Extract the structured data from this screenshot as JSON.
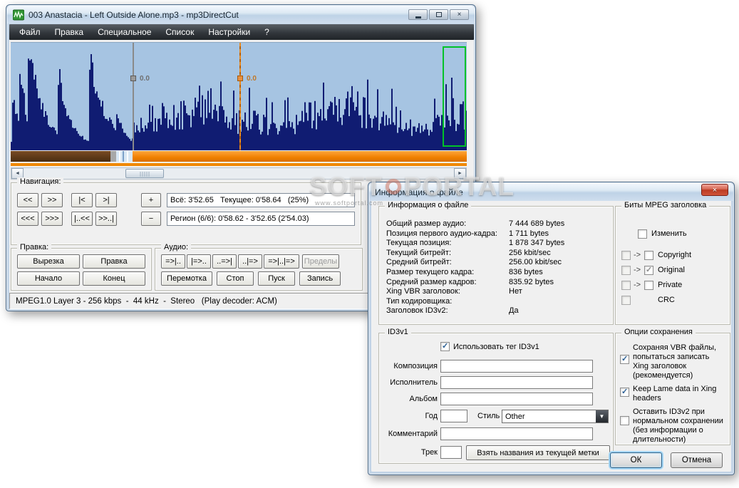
{
  "watermark": {
    "text_left": "SOFT",
    "text_right": "PORTAL",
    "url": "www.softportal.com"
  },
  "main_window": {
    "title": "003 Anastacia - Left Outside Alone.mp3 - mp3DirectCut",
    "menu": [
      "Файл",
      "Правка",
      "Специальное",
      "Список",
      "Настройки",
      "?"
    ],
    "waveform": {
      "marker_left_label": "0.0",
      "marker_right_label": "0.0"
    },
    "navigation": {
      "label": "Навигация:",
      "buttons_row1": [
        "<<",
        ">>",
        "|<",
        ">|",
        "+"
      ],
      "buttons_row2": [
        "<<<",
        ">>>",
        "|..<<",
        ">>..|",
        "−"
      ],
      "total_field": "Всё: 3'52.65   Текущее: 0'58.64   (25%)",
      "region_field": "Регион (6/6): 0'58.62 - 3'52.65 (2'54.03)"
    },
    "edit": {
      "label": "Правка:",
      "buttons": [
        "Вырезка",
        "Правка",
        "Начало",
        "Конец"
      ]
    },
    "audio": {
      "label": "Аудио:",
      "buttons_row1": [
        "=>|..",
        "|=>..",
        "..=>|",
        "..|=>",
        "=>|..|=>",
        "Пределы"
      ],
      "buttons_row2": [
        "Перемотка",
        "Стоп",
        "Пуск",
        "Запись"
      ]
    },
    "status_bar": "MPEG1.0 Layer 3 - 256 kbps  -  44 kHz  -  Stereo   (Play decoder: ACM)"
  },
  "dialog": {
    "title": "Информация о файле",
    "file_info": {
      "title": "Информация о файле",
      "rows": [
        {
          "label": "Общий размер аудио:",
          "value": "7 444 689 bytes"
        },
        {
          "label": "Позиция первого аудио-кадра:",
          "value": "1 711 bytes"
        },
        {
          "label": "Текущая позиция:",
          "value": "1 878 347 bytes"
        },
        {
          "label": "Текущий битрейт:",
          "value": "256 kbit/sec"
        },
        {
          "label": "Средний битрейт:",
          "value": "256.00 kbit/sec"
        },
        {
          "label": "Размер текущего кадра:",
          "value": "836 bytes"
        },
        {
          "label": "Средний размер кадров:",
          "value": "835.92 bytes"
        },
        {
          "label": "Xing VBR заголовок:",
          "value": "Нет"
        },
        {
          "label": "Тип кодировщика:",
          "value": ""
        },
        {
          "label": "Заголовок ID3v2:",
          "value": "Да"
        }
      ]
    },
    "mpeg_bits": {
      "title": "Биты MPEG заголовка",
      "change": {
        "label": "Изменить",
        "checked": false
      },
      "arrow": "->",
      "bits": [
        {
          "label": "Copyright",
          "source_checked": false,
          "checked": false
        },
        {
          "label": "Original",
          "source_checked": false,
          "checked": true
        },
        {
          "label": "Private",
          "source_checked": false,
          "checked": false
        }
      ],
      "crc": {
        "label": "CRC",
        "checked": false
      }
    },
    "id3v1": {
      "title": "ID3v1",
      "use_tag": {
        "label": "Использовать тег ID3v1",
        "checked": true
      },
      "fields": {
        "title_label": "Композиция",
        "artist_label": "Исполнитель",
        "album_label": "Альбом",
        "year_label": "Год",
        "genre_label": "Стиль",
        "genre_value": "Other",
        "comment_label": "Комментарий",
        "track_label": "Трек"
      },
      "take_names_button": "Взять названия из текущей метки"
    },
    "save_options": {
      "title": "Опции сохранения",
      "options": [
        {
          "label": "Сохраняя VBR файлы, попытаться записать Xing заголовок (рекомендуется)",
          "checked": true
        },
        {
          "label": "Keep Lame data in Xing headers",
          "checked": true
        },
        {
          "label": "Оставить ID3v2 при нормальном сохранении (без информации о длительности)",
          "checked": false
        }
      ]
    },
    "ok_button": "ОК",
    "cancel_button": "Отмена"
  }
}
